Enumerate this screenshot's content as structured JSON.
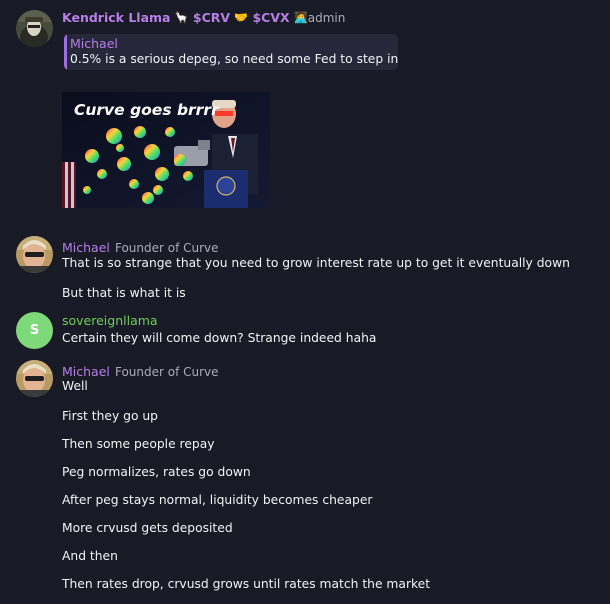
{
  "messages": {
    "m1": {
      "name": "Kendrick Llama",
      "badges": [
        {
          "text": "$CRV",
          "icon": "llama-icon"
        },
        {
          "text": "$CVX",
          "icon": "handshake-icon"
        },
        {
          "text": "admin",
          "icon": "computer-icon"
        }
      ],
      "reply_name": "Michael",
      "reply_text": "0.5% is a serious depeg, so need some Fed to step in",
      "image_caption": "Curve goes brrrr"
    },
    "m2": {
      "name": "Michael",
      "title": "Founder of Curve",
      "lines": [
        "That is so strange that you need to grow interest rate up to get it eventually down",
        "But that is what it is"
      ]
    },
    "m3": {
      "name": "sovereignllama",
      "avatar_letter": "S",
      "avatar_color": "#7ed97a",
      "lines": [
        "Certain they will come down? Strange indeed haha"
      ]
    },
    "m4": {
      "name": "Michael",
      "title": "Founder of Curve",
      "lines": [
        "Well",
        "First they go up",
        "Then some people repay",
        "Peg normalizes, rates go down",
        "After peg stays normal, liquidity becomes cheaper",
        "More crvusd gets deposited",
        "And then",
        "Then rates drop, crvusd grows until rates match the market"
      ]
    }
  },
  "colors": {
    "background": "#181a26",
    "name_purple": "#b67fe6",
    "name_green": "#6fce58",
    "reply_bar": "#9e6ee0"
  }
}
